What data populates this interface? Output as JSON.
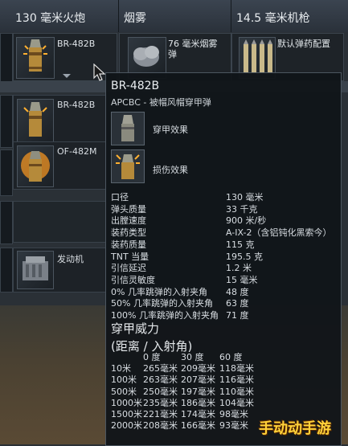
{
  "headers": [
    {
      "label": "130 毫米火炮"
    },
    {
      "label": "烟雾"
    },
    {
      "label": "14.5 毫米机枪"
    }
  ],
  "slots_top": [
    {
      "label": "BR-482B"
    },
    {
      "label": "76 毫米烟雾弹"
    },
    {
      "label": "默认弹药配置"
    }
  ],
  "slots_left": [
    {
      "label": "BR-482B"
    },
    {
      "label": "OF-482M"
    },
    {
      "label": "发动机"
    }
  ],
  "tooltip": {
    "title": "BR-482B",
    "subtitle": "APCBC - 被帽风帽穿甲弹",
    "effects": [
      {
        "label": "穿甲效果"
      },
      {
        "label": "损伤效果"
      }
    ],
    "props": [
      {
        "k": "口径",
        "v": "130 毫米"
      },
      {
        "k": "弹头质量",
        "v": "33 千克"
      },
      {
        "k": "出膛速度",
        "v": "900 米/秒"
      },
      {
        "k": "装药类型",
        "v": "A-IX-2（含铝钝化黑索今）"
      },
      {
        "k": "装药质量",
        "v": "115 克"
      },
      {
        "k": "TNT 当量",
        "v": "195.5 克"
      },
      {
        "k": "引信延迟",
        "v": "1.2 米"
      },
      {
        "k": "引信灵敏度",
        "v": "15 毫米"
      },
      {
        "k": "0% 几率跳弹的入射夹角",
        "v": "48 度"
      },
      {
        "k": "50% 几率跳弹的入射夹角",
        "v": "63 度"
      },
      {
        "k": "100% 几率跳弹的入射夹角",
        "v": "71 度"
      }
    ],
    "pen_title": "穿甲威力",
    "pen_sub": "(距离 / 入射角)",
    "pen_header": [
      "",
      "0 度",
      "30 度",
      "60 度"
    ],
    "pen_rows": [
      [
        "10米",
        "265毫米",
        "209毫米",
        "118毫米"
      ],
      [
        "100米",
        "263毫米",
        "207毫米",
        "116毫米"
      ],
      [
        "500米",
        "250毫米",
        "197毫米",
        "110毫米"
      ],
      [
        "1000米",
        "235毫米",
        "186毫米",
        "104毫米"
      ],
      [
        "1500米",
        "221毫米",
        "174毫米",
        "98毫米"
      ],
      [
        "2000米",
        "208毫米",
        "166毫米",
        "93毫米"
      ]
    ]
  },
  "watermark": "手动动手游"
}
